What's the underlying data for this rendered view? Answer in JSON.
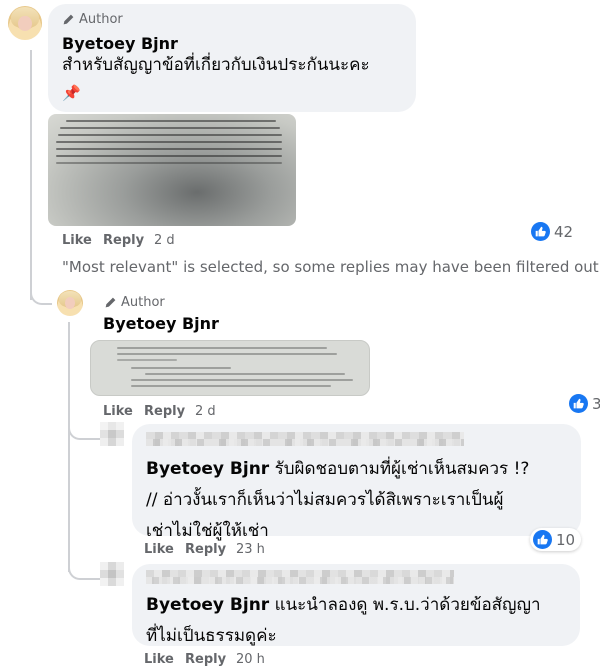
{
  "comment": {
    "author_badge": "Author",
    "name": "Byetoey Bjnr",
    "text": "สำหรับสัญญาข้อที่เกี่ยวกับเงินประกันนะคะ",
    "emoji": "📌",
    "actions": {
      "like": "Like",
      "reply": "Reply",
      "time": "2 d"
    },
    "reaction_count": "42",
    "reaction_icon": "like-thumb-icon",
    "image_icon": "document-photo"
  },
  "filter_notice": "\"Most relevant\" is selected, so some replies may have been filtered out.",
  "reply1": {
    "author_badge": "Author",
    "name": "Byetoey Bjnr",
    "actions": {
      "like": "Like",
      "reply": "Reply",
      "time": "2 d"
    },
    "reaction_count": "3"
  },
  "reply2": {
    "mention": "Byetoey Bjnr",
    "text_line1": "รับผิดชอบตามที่ผู้เช่าเห็นสมควร !?",
    "text_line2": "// อ่าวงั้นเราก็เห็นว่าไม่สมควรได้สิเพราะเราเป็นผู้",
    "text_line3": "เช่าไม่ใช่ผู้ให้เช่า",
    "actions": {
      "like": "Like",
      "reply": "Reply",
      "time": "23 h"
    },
    "reaction_count": "10"
  },
  "reply3": {
    "mention": "Byetoey Bjnr",
    "text_line1": "แนะนำลองดู พ.ร.บ.ว่าด้วยข้อสัญญา",
    "text_line2": "ที่ไม่เป็นธรรมดูค่ะ",
    "actions": {
      "like": "Like",
      "reply": "Reply",
      "time": "20 h"
    }
  },
  "colors": {
    "facebook_blue": "#1877f2",
    "bubble": "#f0f2f5",
    "secondary_text": "#65676b"
  }
}
